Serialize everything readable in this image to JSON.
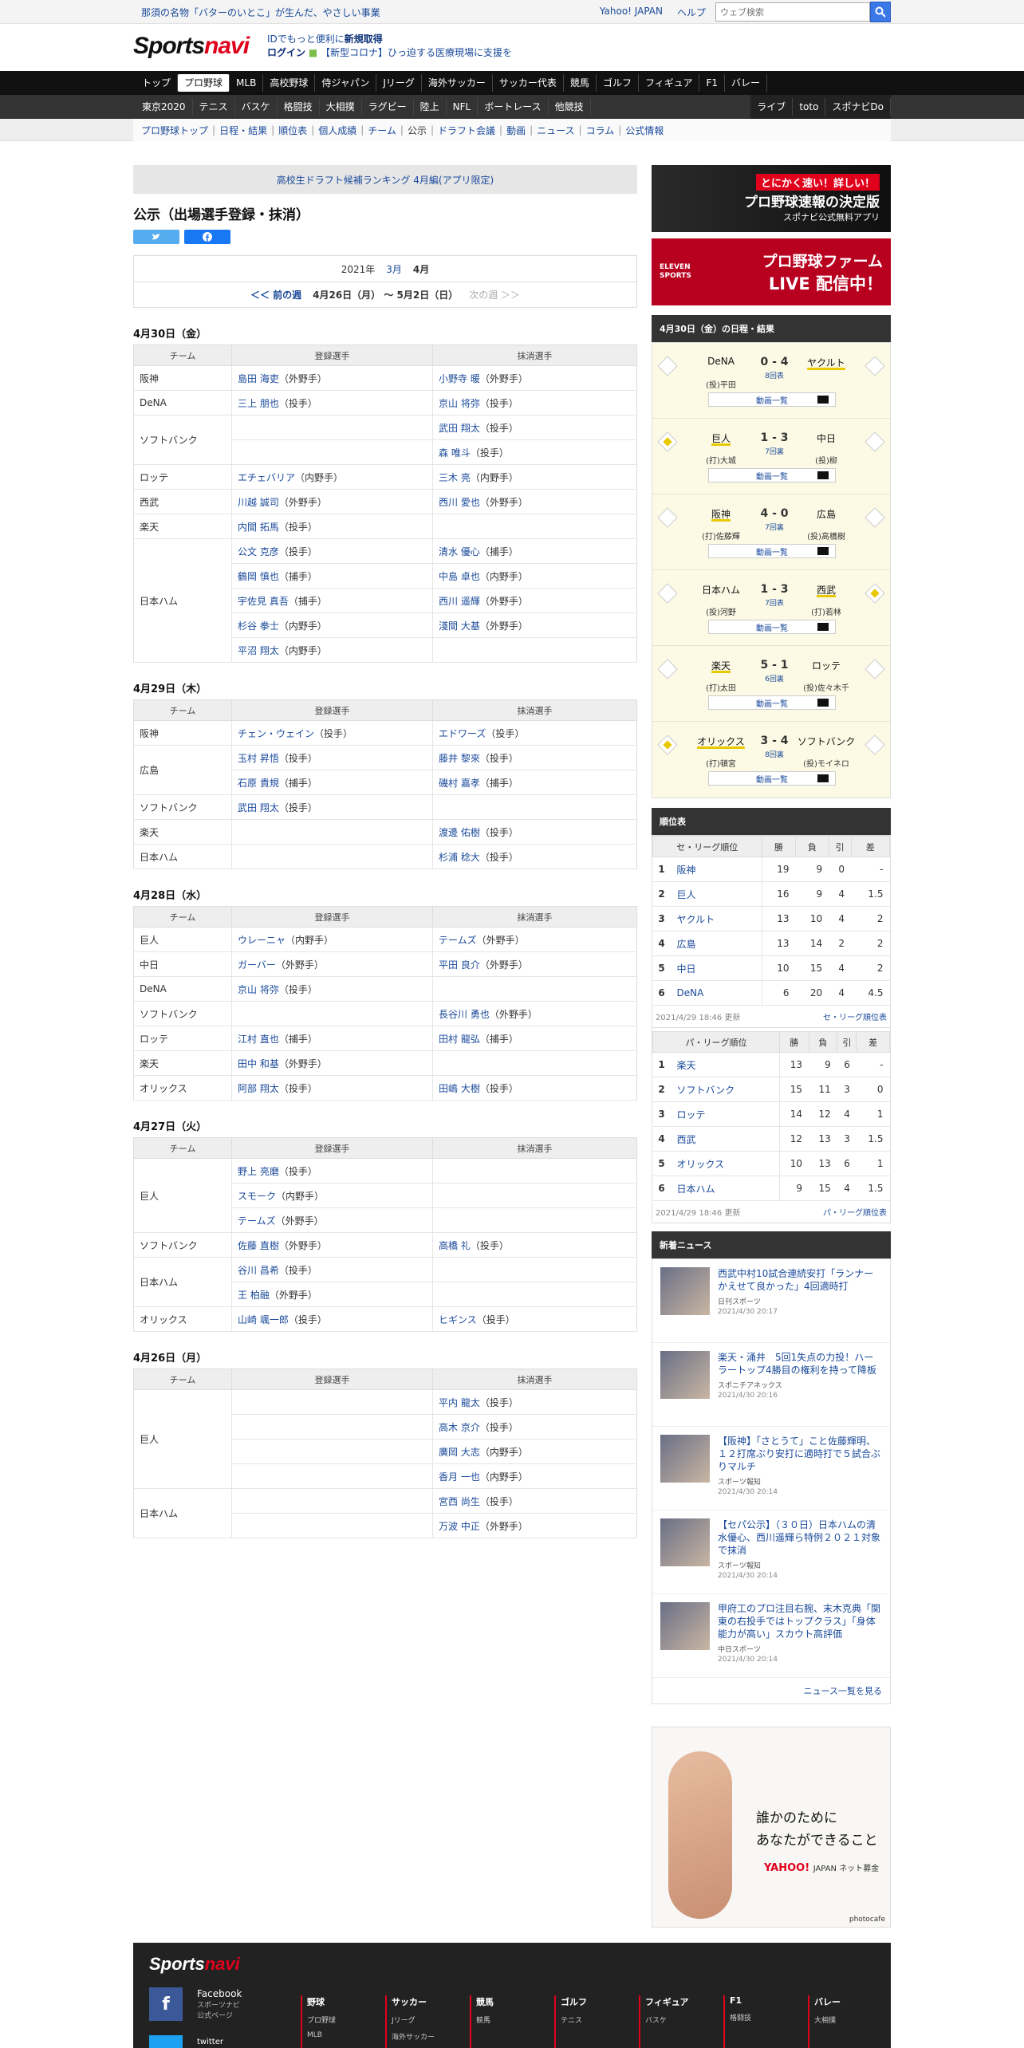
{
  "topbar": {
    "promo": "那須の名物「バターのいとこ」が生んだ、やさしい事業",
    "links": [
      "Yahoo! JAPAN",
      "ヘルプ"
    ],
    "search_placeholder": "ウェブ検索"
  },
  "header": {
    "logo_a": "Sports",
    "logo_b": "navi",
    "id_line1_a": "IDでもっと便利に",
    "id_line1_b": "新規取得",
    "id_line2_a": "ログイン",
    "id_line2_b": "【新型コロナ】ひっ迫する医療現場に支援を"
  },
  "nav1": [
    "トップ",
    "プロ野球",
    "MLB",
    "高校野球",
    "侍ジャパン",
    "Jリーグ",
    "海外サッカー",
    "サッカー代表",
    "競馬",
    "ゴルフ",
    "フィギュア",
    "F1",
    "バレー"
  ],
  "nav2": [
    "東京2020",
    "テニス",
    "バスケ",
    "格闘技",
    "大相撲",
    "ラグビー",
    "陸上",
    "NFL",
    "ボートレース",
    "他競技"
  ],
  "nav2_right": [
    "ライブ",
    "toto",
    "スポナビDo"
  ],
  "subnav": [
    "プロ野球トップ",
    "日程・結果",
    "順位表",
    "個人成績",
    "チーム",
    "公示",
    "ドラフト会議",
    "動画",
    "ニュース",
    "コラム",
    "公式情報"
  ],
  "draft_link": "高校生ドラフト候補ランキング 4月編(アプリ限定)",
  "page_title": "公示（出場選手登録・抹消）",
  "month_nav": {
    "year": "2021年",
    "prev_month": "3月",
    "cur_month": "4月",
    "prev_week": "＜＜ 前の週",
    "range": "4月26日（月） 〜 5月2日（日）",
    "next_week": "次の週 ＞＞"
  },
  "col_headers": {
    "team": "チーム",
    "reg": "登録選手",
    "dereg": "抹消選手"
  },
  "days": [
    {
      "date": "4月30日（金）",
      "rows": [
        {
          "team": "阪神",
          "span": 1,
          "reg": "島田 海吏",
          "reg_pos": "（外野手）",
          "dereg": "小野寺 暖",
          "dereg_pos": "（外野手）"
        },
        {
          "team": "DeNA",
          "span": 1,
          "reg": "三上 朋也",
          "reg_pos": "（投手）",
          "dereg": "京山 将弥",
          "dereg_pos": "（投手）"
        },
        {
          "team": "ソフトバンク",
          "span": 2,
          "reg": "",
          "reg_pos": "",
          "dereg": "武田 翔太",
          "dereg_pos": "（投手）"
        },
        {
          "team": null,
          "reg": "",
          "reg_pos": "",
          "dereg": "森 唯斗",
          "dereg_pos": "（投手）"
        },
        {
          "team": "ロッテ",
          "span": 1,
          "reg": "エチェバリア",
          "reg_pos": "（内野手）",
          "dereg": "三木 亮",
          "dereg_pos": "（内野手）"
        },
        {
          "team": "西武",
          "span": 1,
          "reg": "川越 誠司",
          "reg_pos": "（外野手）",
          "dereg": "西川 愛也",
          "dereg_pos": "（外野手）"
        },
        {
          "team": "楽天",
          "span": 1,
          "reg": "内間 拓馬",
          "reg_pos": "（投手）",
          "dereg": "",
          "dereg_pos": ""
        },
        {
          "team": "日本ハム",
          "span": 5,
          "reg": "公文 克彦",
          "reg_pos": "（投手）",
          "dereg": "清水 優心",
          "dereg_pos": "（捕手）"
        },
        {
          "team": null,
          "reg": "鶴岡 慎也",
          "reg_pos": "（捕手）",
          "dereg": "中島 卓也",
          "dereg_pos": "（内野手）"
        },
        {
          "team": null,
          "reg": "宇佐見 真吾",
          "reg_pos": "（捕手）",
          "dereg": "西川 遥輝",
          "dereg_pos": "（外野手）"
        },
        {
          "team": null,
          "reg": "杉谷 拳士",
          "reg_pos": "（内野手）",
          "dereg": "淺間 大基",
          "dereg_pos": "（外野手）"
        },
        {
          "team": null,
          "reg": "平沼 翔太",
          "reg_pos": "（内野手）",
          "dereg": "",
          "dereg_pos": ""
        }
      ]
    },
    {
      "date": "4月29日（木）",
      "rows": [
        {
          "team": "阪神",
          "span": 1,
          "reg": "チェン・ウェイン",
          "reg_pos": "（投手）",
          "dereg": "エドワーズ",
          "dereg_pos": "（投手）"
        },
        {
          "team": "広島",
          "span": 2,
          "reg": "玉村 昇悟",
          "reg_pos": "（投手）",
          "dereg": "藤井 黎來",
          "dereg_pos": "（投手）"
        },
        {
          "team": null,
          "reg": "石原 貴規",
          "reg_pos": "（捕手）",
          "dereg": "磯村 嘉孝",
          "dereg_pos": "（捕手）"
        },
        {
          "team": "ソフトバンク",
          "span": 1,
          "reg": "武田 翔太",
          "reg_pos": "（投手）",
          "dereg": "",
          "dereg_pos": ""
        },
        {
          "team": "楽天",
          "span": 1,
          "reg": "",
          "reg_pos": "",
          "dereg": "渡邊 佑樹",
          "dereg_pos": "（投手）"
        },
        {
          "team": "日本ハム",
          "span": 1,
          "reg": "",
          "reg_pos": "",
          "dereg": "杉浦 稔大",
          "dereg_pos": "（投手）"
        }
      ]
    },
    {
      "date": "4月28日（水）",
      "rows": [
        {
          "team": "巨人",
          "span": 1,
          "reg": "ウレーニャ",
          "reg_pos": "（内野手）",
          "dereg": "テームズ",
          "dereg_pos": "（外野手）"
        },
        {
          "team": "中日",
          "span": 1,
          "reg": "ガーバー",
          "reg_pos": "（外野手）",
          "dereg": "平田 良介",
          "dereg_pos": "（外野手）"
        },
        {
          "team": "DeNA",
          "span": 1,
          "reg": "京山 将弥",
          "reg_pos": "（投手）",
          "dereg": "",
          "dereg_pos": ""
        },
        {
          "team": "ソフトバンク",
          "span": 1,
          "reg": "",
          "reg_pos": "",
          "dereg": "長谷川 勇也",
          "dereg_pos": "（外野手）"
        },
        {
          "team": "ロッテ",
          "span": 1,
          "reg": "江村 直也",
          "reg_pos": "（捕手）",
          "dereg": "田村 龍弘",
          "dereg_pos": "（捕手）"
        },
        {
          "team": "楽天",
          "span": 1,
          "reg": "田中 和基",
          "reg_pos": "（外野手）",
          "dereg": "",
          "dereg_pos": ""
        },
        {
          "team": "オリックス",
          "span": 1,
          "reg": "阿部 翔太",
          "reg_pos": "（投手）",
          "dereg": "田嶋 大樹",
          "dereg_pos": "（投手）"
        }
      ]
    },
    {
      "date": "4月27日（火）",
      "rows": [
        {
          "team": "巨人",
          "span": 3,
          "reg": "野上 亮磨",
          "reg_pos": "（投手）",
          "dereg": "",
          "dereg_pos": ""
        },
        {
          "team": null,
          "reg": "スモーク",
          "reg_pos": "（内野手）",
          "dereg": "",
          "dereg_pos": ""
        },
        {
          "team": null,
          "reg": "テームズ",
          "reg_pos": "（外野手）",
          "dereg": "",
          "dereg_pos": ""
        },
        {
          "team": "ソフトバンク",
          "span": 1,
          "reg": "佐藤 直樹",
          "reg_pos": "（外野手）",
          "dereg": "高橋 礼",
          "dereg_pos": "（投手）"
        },
        {
          "team": "日本ハム",
          "span": 2,
          "reg": "谷川 昌希",
          "reg_pos": "（投手）",
          "dereg": "",
          "dereg_pos": ""
        },
        {
          "team": null,
          "reg": "王 柏融",
          "reg_pos": "（外野手）",
          "dereg": "",
          "dereg_pos": ""
        },
        {
          "team": "オリックス",
          "span": 1,
          "reg": "山崎 颯一郎",
          "reg_pos": "（投手）",
          "dereg": "ヒギンス",
          "dereg_pos": "（投手）"
        }
      ]
    },
    {
      "date": "4月26日（月）",
      "rows": [
        {
          "team": "巨人",
          "span": 4,
          "reg": "",
          "reg_pos": "",
          "dereg": "平内 龍太",
          "dereg_pos": "（投手）"
        },
        {
          "team": null,
          "reg": "",
          "reg_pos": "",
          "dereg": "高木 京介",
          "dereg_pos": "（投手）"
        },
        {
          "team": null,
          "reg": "",
          "reg_pos": "",
          "dereg": "廣岡 大志",
          "dereg_pos": "（内野手）"
        },
        {
          "team": null,
          "reg": "",
          "reg_pos": "",
          "dereg": "香月 一也",
          "dereg_pos": "（内野手）"
        },
        {
          "team": "日本ハム",
          "span": 2,
          "reg": "",
          "reg_pos": "",
          "dereg": "宮西 尚生",
          "dereg_pos": "（投手）"
        },
        {
          "team": null,
          "reg": "",
          "reg_pos": "",
          "dereg": "万波 中正",
          "dereg_pos": "（外野手）"
        }
      ]
    }
  ],
  "banners": {
    "app_a": "とにかく速い！詳しい！",
    "app_b": "プロ野球速報の決定版",
    "app_c": "スポナビ公式無料アプリ",
    "eleven_a": "ELEVEN SPORTS",
    "eleven_b": "プロ野球ファーム",
    "eleven_c": "LIVE 配信中！"
  },
  "schedule": {
    "title": "4月30日（金）の日程・結果",
    "link_label": "動画一覧",
    "games": [
      {
        "home": "DeNA",
        "away": "ヤクルト",
        "score": "0 - 4",
        "inning": "8回表",
        "home_p": "(投)平田",
        "away_p": "",
        "winner": "away",
        "home_dia": "",
        "away_dia": ""
      },
      {
        "home": "巨人",
        "away": "中日",
        "score": "1 - 3",
        "inning": "7回裏",
        "home_p": "(打)大城",
        "away_p": "(投)柳",
        "winner": "home",
        "home_dia": "y",
        "away_dia": ""
      },
      {
        "home": "阪神",
        "away": "広島",
        "score": "4 - 0",
        "inning": "7回裏",
        "home_p": "(打)佐藤輝",
        "away_p": "(投)高橋樹",
        "winner": "home",
        "home_dia": "",
        "away_dia": ""
      },
      {
        "home": "日本ハム",
        "away": "西武",
        "score": "1 - 3",
        "inning": "7回表",
        "home_p": "(投)河野",
        "away_p": "(打)若林",
        "winner": "away",
        "home_dia": "",
        "away_dia": "y"
      },
      {
        "home": "楽天",
        "away": "ロッテ",
        "score": "5 - 1",
        "inning": "6回裏",
        "home_p": "(打)太田",
        "away_p": "(投)佐々木千",
        "winner": "home",
        "home_dia": "",
        "away_dia": ""
      },
      {
        "home": "オリックス",
        "away": "ソフトバンク",
        "score": "3 - 4",
        "inning": "8回裏",
        "home_p": "(打)頓宮",
        "away_p": "(投)モイネロ",
        "winner": "home",
        "home_dia": "y",
        "away_dia": ""
      }
    ]
  },
  "standings_title": "順位表",
  "standings_cols": [
    "勝",
    "負",
    "引",
    "差"
  ],
  "central": {
    "title": "セ・リーグ順位",
    "updated": "2021/4/29 18:46 更新",
    "link": "セ・リーグ順位表",
    "rows": [
      [
        "1",
        "阪神",
        "19",
        "9",
        "0",
        "-"
      ],
      [
        "2",
        "巨人",
        "16",
        "9",
        "4",
        "1.5"
      ],
      [
        "3",
        "ヤクルト",
        "13",
        "10",
        "4",
        "2"
      ],
      [
        "4",
        "広島",
        "13",
        "14",
        "2",
        "2"
      ],
      [
        "5",
        "中日",
        "10",
        "15",
        "4",
        "2"
      ],
      [
        "6",
        "DeNA",
        "6",
        "20",
        "4",
        "4.5"
      ]
    ]
  },
  "pacific": {
    "title": "パ・リーグ順位",
    "updated": "2021/4/29 18:46 更新",
    "link": "パ・リーグ順位表",
    "rows": [
      [
        "1",
        "楽天",
        "13",
        "9",
        "6",
        "-"
      ],
      [
        "2",
        "ソフトバンク",
        "15",
        "11",
        "3",
        "0"
      ],
      [
        "3",
        "ロッテ",
        "14",
        "12",
        "4",
        "1"
      ],
      [
        "4",
        "西武",
        "12",
        "13",
        "3",
        "1.5"
      ],
      [
        "5",
        "オリックス",
        "10",
        "13",
        "6",
        "1"
      ],
      [
        "6",
        "日本ハム",
        "9",
        "15",
        "4",
        "1.5"
      ]
    ]
  },
  "news": {
    "title": "新着ニュース",
    "more": "ニュース一覧を見る",
    "items": [
      {
        "title": "西武中村10試合連続安打「ランナーかえせて良かった」4回適時打",
        "source": "日刊スポーツ",
        "date": "2021/4/30 20:17"
      },
      {
        "title": "楽天・涌井　5回1失点の力投！ハーラートップ4勝目の権利を持って降板",
        "source": "スポニチアネックス",
        "date": "2021/4/30 20:16"
      },
      {
        "title": "【阪神】「さとうて」こと佐藤輝明、１２打席ぶり安打に適時打で５試合ぶりマルチ",
        "source": "スポーツ報知",
        "date": "2021/4/30 20:14"
      },
      {
        "title": "【セパ公示】（３０日）日本ハムの清水優心、西川遥輝ら特例２０２１対象で抹消",
        "source": "スポーツ報知",
        "date": "2021/4/30 20:14"
      },
      {
        "title": "甲府工のプロ注目右腕、末木克典「関東の右投手ではトップクラス」「身体能力が高い」スカウト高評価",
        "source": "中日スポーツ",
        "date": "2021/4/30 20:14"
      }
    ]
  },
  "ad": {
    "line1": "誰かのために",
    "line2": "あなたができること",
    "logo": "YAHOO!",
    "logo_sub": "JAPAN ネット募金",
    "credit": "photocafe"
  },
  "footer": {
    "logo_a": "Sports",
    "logo_b": "navi",
    "fb_label": "Facebook",
    "fb_sub1": "スポーツナビ",
    "fb_sub2": "公式ページ",
    "tw_label": "twitter",
    "cols": [
      [
        "野球",
        "プロ野球",
        "MLB"
      ],
      [
        "サッカー",
        "Jリーグ",
        "海外サッカー"
      ],
      [
        "競馬",
        "競馬"
      ],
      [
        "ゴルフ",
        "テニス"
      ],
      [
        "フィギュア",
        "バスケ"
      ],
      [
        "F1",
        "格闘技"
      ],
      [
        "バレー",
        "大相撲"
      ]
    ]
  }
}
